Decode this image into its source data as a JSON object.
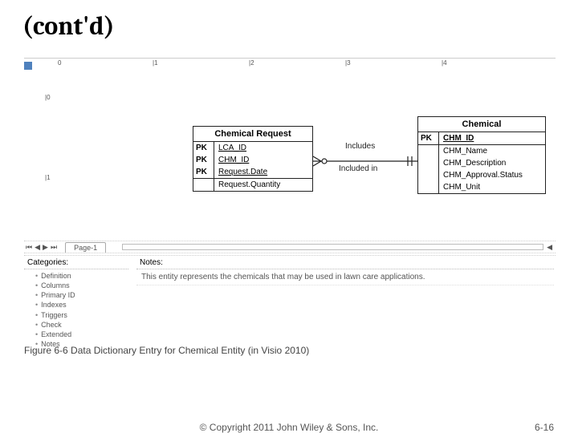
{
  "title": "(cont'd)",
  "ruler_h": [
    "0",
    "|1",
    "|2",
    "|3",
    "|4"
  ],
  "ruler_v": [
    "|0",
    "|1"
  ],
  "entity_request": {
    "title": "Chemical Request",
    "pk_rows": [
      {
        "pk": "PK",
        "attr": "LCA_ID",
        "underline": true
      },
      {
        "pk": "PK",
        "attr": "CHM_ID",
        "underline": true
      },
      {
        "pk": "PK",
        "attr": "Request.Date",
        "underline": true
      }
    ],
    "rows": [
      {
        "attr": "Request.Quantity"
      }
    ]
  },
  "entity_chemical": {
    "title": "Chemical",
    "pk_rows": [
      {
        "pk": "PK",
        "attr": "CHM_ID",
        "underline": true,
        "bold": true
      }
    ],
    "rows": [
      {
        "attr": "CHM_Name"
      },
      {
        "attr": "CHM_Description"
      },
      {
        "attr": "CHM_Approval.Status"
      },
      {
        "attr": "CHM_Unit"
      }
    ]
  },
  "relationship": {
    "label_forward": "Includes",
    "label_backward": "Included in"
  },
  "page_tab": "Page-1",
  "nav_glyphs": [
    "⏮",
    "◀",
    "▶",
    "⏭"
  ],
  "scroll_glyph": "◀",
  "categories_header": "Categories:",
  "categories": [
    "Definition",
    "Columns",
    "Primary ID",
    "Indexes",
    "Triggers",
    "Check",
    "Extended",
    "Notes"
  ],
  "notes_header": "Notes:",
  "notes_body": "This entity represents the chemicals that may be used in lawn care applications.",
  "caption": "Figure 6-6  Data Dictionary Entry for Chemical Entity (in Visio 2010)",
  "footer_copy": "© Copyright 2011 John Wiley & Sons, Inc.",
  "footer_page": "6-16"
}
